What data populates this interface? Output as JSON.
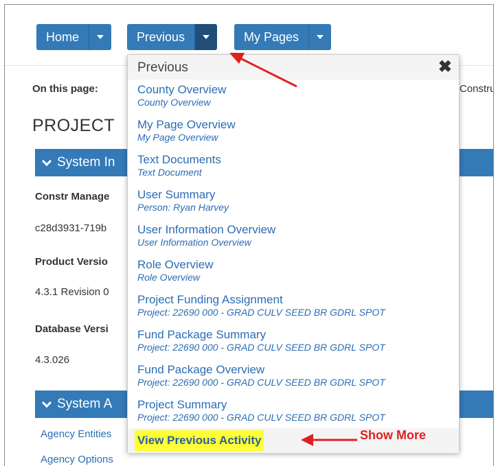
{
  "topnav": {
    "home_label": "Home",
    "previous_label": "Previous",
    "mypages_label": "My Pages"
  },
  "page": {
    "on_this_page_label": "On this page:",
    "on_this_page_right": "Constru",
    "project_title": "PROJECT",
    "sections": [
      {
        "title": "System In"
      },
      {
        "title": "System A"
      }
    ],
    "fields": {
      "constr_label": "Constr Manage",
      "constr_value": "c28d3931-719b",
      "product_label": "Product Versio",
      "product_value": "4.3.1 Revision 0",
      "db_label": "Database Versi",
      "db_value": "4.3.026"
    },
    "links": [
      "Agency Entities",
      "Agency Options"
    ]
  },
  "dropdown": {
    "title": "Previous",
    "close_glyph": "✖",
    "items": [
      {
        "title": "County Overview",
        "subtitle": "County Overview"
      },
      {
        "title": "My Page Overview",
        "subtitle": "My Page Overview"
      },
      {
        "title": "Text Documents",
        "subtitle": "Text Document"
      },
      {
        "title": "User Summary",
        "subtitle": "Person: Ryan Harvey"
      },
      {
        "title": "User Information Overview",
        "subtitle": "User Information Overview"
      },
      {
        "title": "Role Overview",
        "subtitle": "Role Overview"
      },
      {
        "title": "Project Funding Assignment",
        "subtitle": "Project: 22690 000 - GRAD CULV SEED BR GDRL SPOT"
      },
      {
        "title": "Fund Package Summary",
        "subtitle": "Project: 22690 000 - GRAD CULV SEED BR GDRL SPOT"
      },
      {
        "title": "Fund Package Overview",
        "subtitle": "Project: 22690 000 - GRAD CULV SEED BR GDRL SPOT"
      },
      {
        "title": "Project Summary",
        "subtitle": "Project: 22690 000 - GRAD CULV SEED BR GDRL SPOT"
      }
    ],
    "view_previous_label": "View Previous Activity"
  },
  "annotation": {
    "show_more_label": "Show More",
    "color": "#e02020"
  },
  "colors": {
    "primary": "#337ab7",
    "link": "#2a6db5",
    "highlight": "#ffff33"
  }
}
